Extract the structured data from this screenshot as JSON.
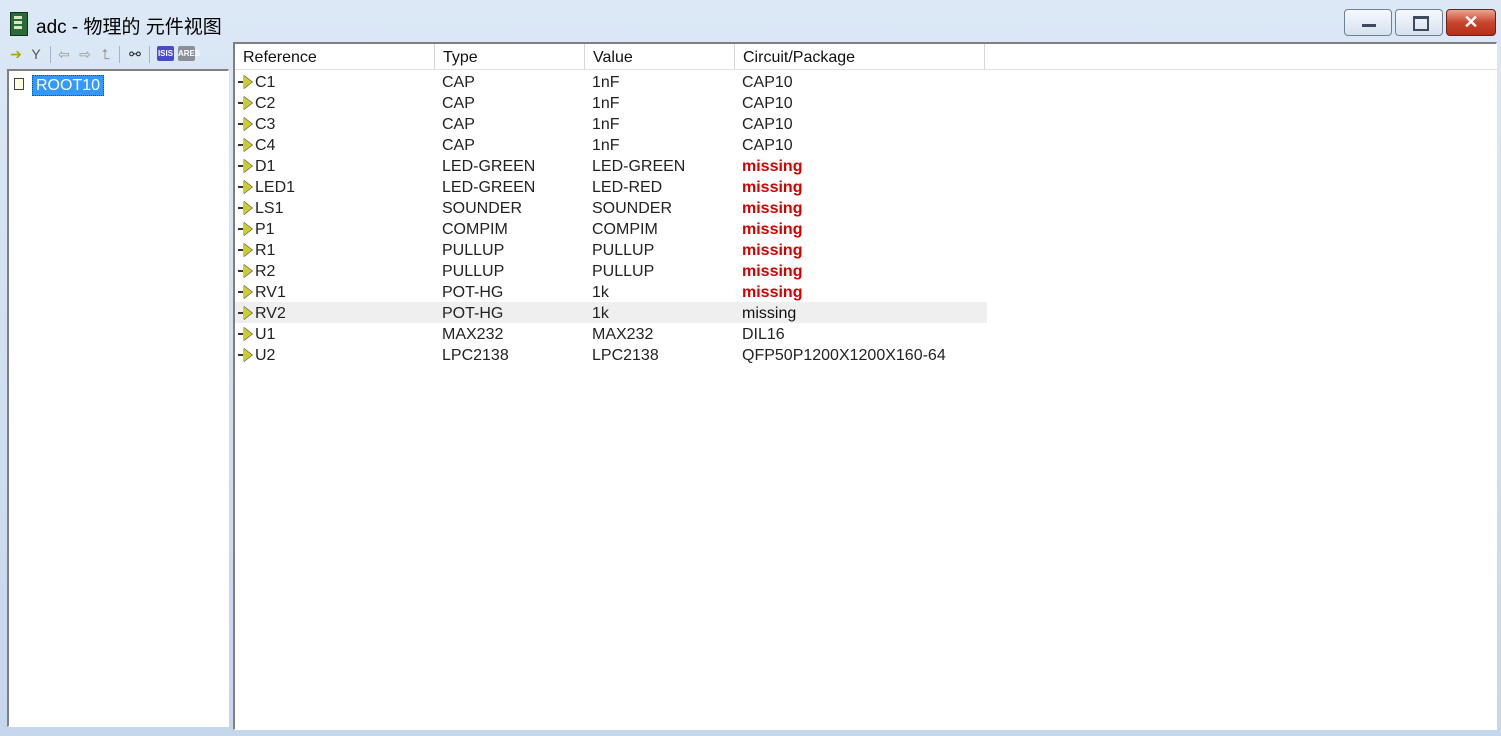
{
  "window": {
    "title": "adc - 物理的 元件视图",
    "close_glyph": "✕"
  },
  "toolbar": {
    "icons": [
      "arrow-right-icon",
      "branch-icon",
      "back-arrow-icon",
      "forward-arrow-icon",
      "up-arrow-icon",
      "binoculars-icon",
      "isis-icon",
      "ares-icon"
    ],
    "isis_label": "ISIS",
    "ares_label": "ARES"
  },
  "tree": {
    "root_label": "ROOT10"
  },
  "table": {
    "columns": [
      "Reference",
      "Type",
      "Value",
      "Circuit/Package"
    ],
    "rows": [
      {
        "ref": "C1",
        "type": "CAP",
        "value": "1nF",
        "package": "CAP10",
        "missing": false
      },
      {
        "ref": "C2",
        "type": "CAP",
        "value": "1nF",
        "package": "CAP10",
        "missing": false
      },
      {
        "ref": "C3",
        "type": "CAP",
        "value": "1nF",
        "package": "CAP10",
        "missing": false
      },
      {
        "ref": "C4",
        "type": "CAP",
        "value": "1nF",
        "package": "CAP10",
        "missing": false
      },
      {
        "ref": "D1",
        "type": "LED-GREEN",
        "value": "LED-GREEN",
        "package": "missing",
        "missing": true
      },
      {
        "ref": "LED1",
        "type": "LED-GREEN",
        "value": "LED-RED",
        "package": "missing",
        "missing": true
      },
      {
        "ref": "LS1",
        "type": "SOUNDER",
        "value": "SOUNDER",
        "package": "missing",
        "missing": true
      },
      {
        "ref": "P1",
        "type": "COMPIM",
        "value": "COMPIM",
        "package": "missing",
        "missing": true
      },
      {
        "ref": "R1",
        "type": "PULLUP",
        "value": "PULLUP",
        "package": "missing",
        "missing": true
      },
      {
        "ref": "R2",
        "type": "PULLUP",
        "value": "PULLUP",
        "package": "missing",
        "missing": true
      },
      {
        "ref": "RV1",
        "type": "POT-HG",
        "value": "1k",
        "package": "missing",
        "missing": true
      },
      {
        "ref": "RV2",
        "type": "POT-HG",
        "value": "1k",
        "package": "missing",
        "missing": true,
        "highlighted": true
      },
      {
        "ref": "U1",
        "type": "MAX232",
        "value": "MAX232",
        "package": "DIL16",
        "missing": false
      },
      {
        "ref": "U2",
        "type": "LPC2138",
        "value": "LPC2138",
        "package": "QFP50P1200X1200X160-64",
        "missing": false
      }
    ]
  },
  "colors": {
    "missing_text": "#d40000",
    "selection": "#3399ff",
    "highlight_row": "#efefef"
  }
}
